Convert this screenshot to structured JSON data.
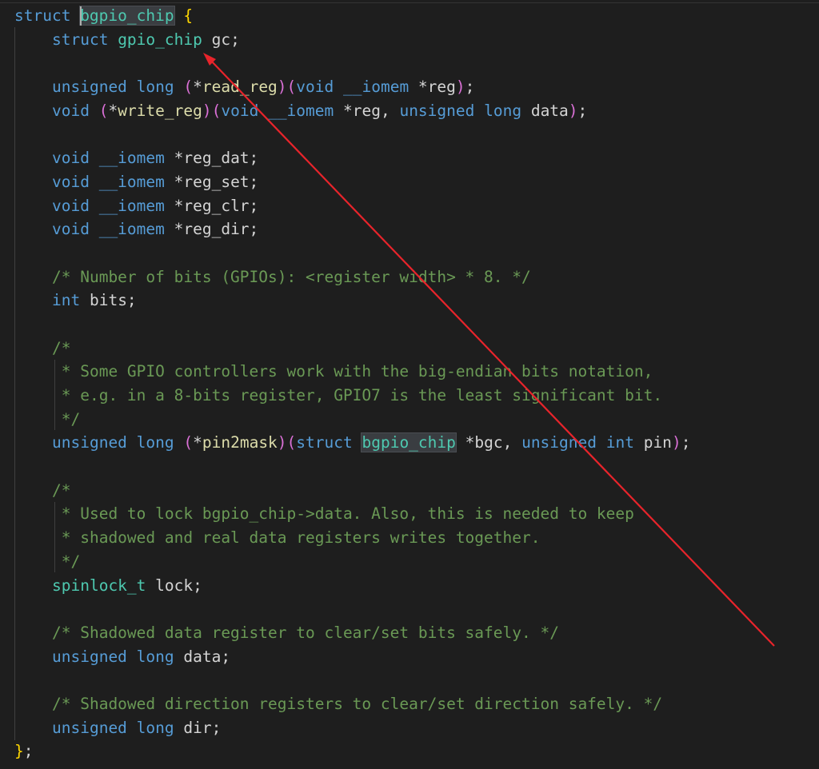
{
  "lines": [
    [
      {
        "t": "struct ",
        "k": "keyword"
      },
      {
        "t": "bgpio_chip",
        "k": "type",
        "hl": true
      },
      {
        "t": " ",
        "k": "plain"
      },
      {
        "t": "{",
        "k": "brace"
      }
    ],
    [
      {
        "t": "struct ",
        "k": "keyword"
      },
      {
        "t": "gpio_chip",
        "k": "type"
      },
      {
        "t": " gc;",
        "k": "plain"
      }
    ],
    [],
    [
      {
        "t": "unsigned long ",
        "k": "keyword"
      },
      {
        "t": "(",
        "k": "paren"
      },
      {
        "t": "*",
        "k": "plain"
      },
      {
        "t": "read_reg",
        "k": "func"
      },
      {
        "t": ")",
        "k": "paren"
      },
      {
        "t": "(",
        "k": "paren"
      },
      {
        "t": "void ",
        "k": "keyword"
      },
      {
        "t": "__iomem",
        "k": "keyword"
      },
      {
        "t": " *reg",
        "k": "plain"
      },
      {
        "t": ")",
        "k": "paren"
      },
      {
        "t": ";",
        "k": "plain"
      }
    ],
    [
      {
        "t": "void ",
        "k": "keyword"
      },
      {
        "t": "(",
        "k": "paren"
      },
      {
        "t": "*",
        "k": "plain"
      },
      {
        "t": "write_reg",
        "k": "func"
      },
      {
        "t": ")",
        "k": "paren"
      },
      {
        "t": "(",
        "k": "paren"
      },
      {
        "t": "void ",
        "k": "keyword"
      },
      {
        "t": "__iomem",
        "k": "keyword"
      },
      {
        "t": " *reg, ",
        "k": "plain"
      },
      {
        "t": "unsigned long ",
        "k": "keyword"
      },
      {
        "t": "data",
        "k": "plain"
      },
      {
        "t": ")",
        "k": "paren"
      },
      {
        "t": ";",
        "k": "plain"
      }
    ],
    [],
    [
      {
        "t": "void ",
        "k": "keyword"
      },
      {
        "t": "__iomem",
        "k": "keyword"
      },
      {
        "t": " *reg_dat;",
        "k": "plain"
      }
    ],
    [
      {
        "t": "void ",
        "k": "keyword"
      },
      {
        "t": "__iomem",
        "k": "keyword"
      },
      {
        "t": " *reg_set;",
        "k": "plain"
      }
    ],
    [
      {
        "t": "void ",
        "k": "keyword"
      },
      {
        "t": "__iomem",
        "k": "keyword"
      },
      {
        "t": " *reg_clr;",
        "k": "plain"
      }
    ],
    [
      {
        "t": "void ",
        "k": "keyword"
      },
      {
        "t": "__iomem",
        "k": "keyword"
      },
      {
        "t": " *reg_dir;",
        "k": "plain"
      }
    ],
    [],
    [
      {
        "t": "/* Number of bits (GPIOs): <register width> * 8. */",
        "k": "comment"
      }
    ],
    [
      {
        "t": "int ",
        "k": "keyword"
      },
      {
        "t": "bits;",
        "k": "plain"
      }
    ],
    [],
    [
      {
        "t": "/*",
        "k": "comment"
      }
    ],
    [
      {
        "t": " * Some GPIO controllers work with the big-endian bits notation,",
        "k": "comment"
      }
    ],
    [
      {
        "t": " * e.g. in a 8-bits register, GPIO7 is the least significant bit.",
        "k": "comment"
      }
    ],
    [
      {
        "t": " */",
        "k": "comment"
      }
    ],
    [
      {
        "t": "unsigned long ",
        "k": "keyword"
      },
      {
        "t": "(",
        "k": "paren"
      },
      {
        "t": "*",
        "k": "plain"
      },
      {
        "t": "pin2mask",
        "k": "func"
      },
      {
        "t": ")",
        "k": "paren"
      },
      {
        "t": "(",
        "k": "paren"
      },
      {
        "t": "struct ",
        "k": "keyword"
      },
      {
        "t": "bgpio_chip",
        "k": "type",
        "hl": true
      },
      {
        "t": " *bgc, ",
        "k": "plain"
      },
      {
        "t": "unsigned int ",
        "k": "keyword"
      },
      {
        "t": "pin",
        "k": "plain"
      },
      {
        "t": ")",
        "k": "paren"
      },
      {
        "t": ";",
        "k": "plain"
      }
    ],
    [],
    [
      {
        "t": "/*",
        "k": "comment"
      }
    ],
    [
      {
        "t": " * Used to lock bgpio_chip->data. Also, this is needed to keep",
        "k": "comment"
      }
    ],
    [
      {
        "t": " * shadowed and real data registers writes together.",
        "k": "comment"
      }
    ],
    [
      {
        "t": " */",
        "k": "comment"
      }
    ],
    [
      {
        "t": "spinlock_t",
        "k": "type"
      },
      {
        "t": " lock;",
        "k": "plain"
      }
    ],
    [],
    [
      {
        "t": "/* Shadowed data register to clear/set bits safely. */",
        "k": "comment"
      }
    ],
    [
      {
        "t": "unsigned long ",
        "k": "keyword"
      },
      {
        "t": "data;",
        "k": "plain"
      }
    ],
    [],
    [
      {
        "t": "/* Shadowed direction registers to clear/set direction safely. */",
        "k": "comment"
      }
    ],
    [
      {
        "t": "unsigned long ",
        "k": "keyword"
      },
      {
        "t": "dir;",
        "k": "plain"
      }
    ],
    [
      {
        "t": "}",
        "k": "brace"
      },
      {
        "t": ";",
        "k": "plain"
      }
    ]
  ],
  "annotation": {
    "color": "#e8242b"
  }
}
